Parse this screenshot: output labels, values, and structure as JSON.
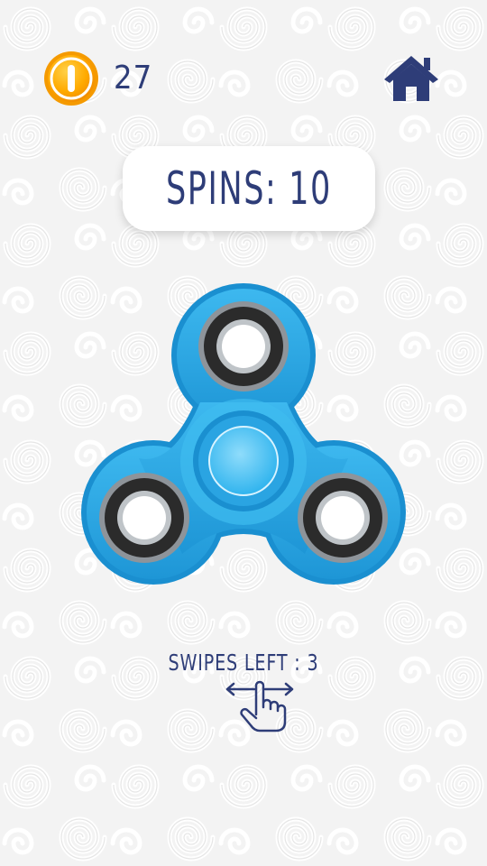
{
  "hud": {
    "coins": "27",
    "icons": {
      "coin": "coin-icon",
      "home": "home-icon"
    }
  },
  "score": {
    "spins_label": "SPINS: 10"
  },
  "spinner": {
    "icon": "fidget-spinner",
    "colors": {
      "body": "#26a6e4",
      "body_light": "#5ac8f5",
      "bearing": "#2b2b2b",
      "accent": "#2e3d78"
    }
  },
  "hint": {
    "swipes_label": "SWIPES LEFT : 3",
    "icon": "swipe-hand-icon"
  }
}
